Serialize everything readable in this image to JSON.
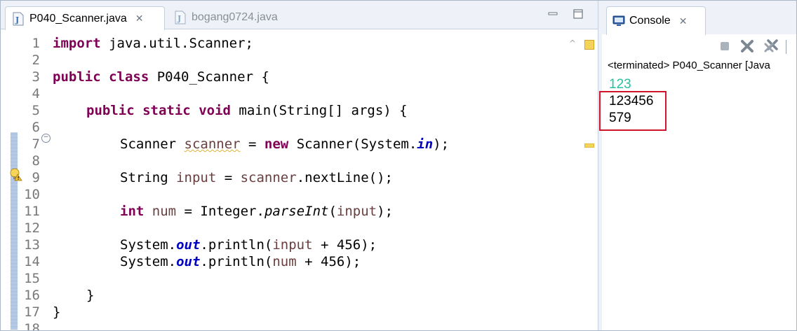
{
  "editor": {
    "tabs": [
      {
        "label": "P040_Scanner.java",
        "active": true
      },
      {
        "label": "bogang0724.java",
        "active": false
      }
    ],
    "line_numbers": [
      "1",
      "2",
      "3",
      "4",
      "5",
      "6",
      "7",
      "8",
      "9",
      "10",
      "11",
      "12",
      "13",
      "14",
      "15",
      "16",
      "17",
      "18"
    ],
    "lines": {
      "l1_kw": "import",
      "l1_rest": " java.util.Scanner;",
      "l3_kw1": "public",
      "l3_kw2": "class",
      "l3_rest": " P040_Scanner {",
      "l5_kw1": "public",
      "l5_kw2": "static",
      "l5_kw3": "void",
      "l5_rest": " main(String[] args) {",
      "l7_a": "Scanner ",
      "l7_var": "scanner",
      "l7_b": " = ",
      "l7_kw": "new",
      "l7_c": " Scanner(System.",
      "l7_st": "in",
      "l7_d": ");",
      "l9_a": "String ",
      "l9_var": "input",
      "l9_b": " = ",
      "l9_var2": "scanner",
      "l9_c": ".nextLine();",
      "l11_kw": "int",
      "l11_a": " ",
      "l11_var": "num",
      "l11_b": " = Integer.",
      "l11_it": "parseInt",
      "l11_c": "(",
      "l11_var2": "input",
      "l11_d": ");",
      "l13_a": "System.",
      "l13_st": "out",
      "l13_b": ".println(",
      "l13_var": "input",
      "l13_c": " + 456);",
      "l14_a": "System.",
      "l14_st": "out",
      "l14_b": ".println(",
      "l14_var": "num",
      "l14_c": " + 456);",
      "l16": "}",
      "l17": "}"
    },
    "colors": {
      "keyword": "#7f0055",
      "static_field": "#0000c0",
      "local_var": "#6a3e3e"
    }
  },
  "console": {
    "tab_label": "Console",
    "status": "<terminated> P040_Scanner [Java",
    "input_echo": "123",
    "output_lines": [
      "123456",
      "579"
    ],
    "colors": {
      "input": "#28c0a0",
      "highlight": "#d0142c"
    }
  }
}
